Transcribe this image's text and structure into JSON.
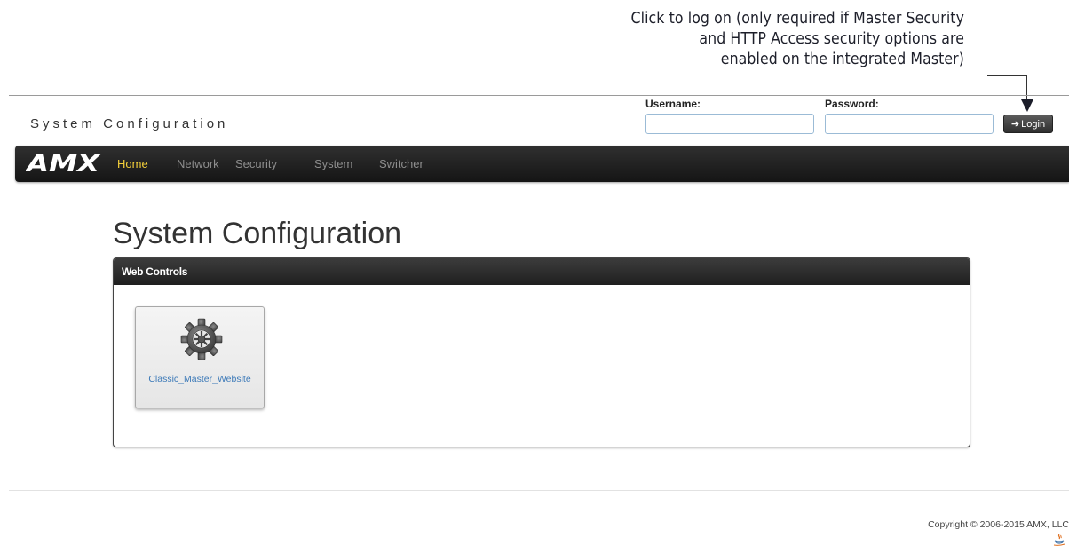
{
  "callout": {
    "lines": [
      "Click to log on (only required if Master Security",
      "and HTTP Access security options are",
      "enabled on the integrated Master)"
    ]
  },
  "header": {
    "app_title": "System Configuration",
    "username_label": "Username:",
    "password_label": "Password:",
    "username_value": "",
    "password_value": "",
    "login_icon": "login-icon",
    "login_label": "Login"
  },
  "nav": {
    "logo_text": "AMX",
    "items": [
      {
        "label": "Home",
        "active": true
      },
      {
        "label": "Network",
        "active": false
      },
      {
        "label": "Security",
        "active": false
      },
      {
        "label": "System",
        "active": false
      },
      {
        "label": "Switcher",
        "active": false
      }
    ],
    "active_color": "#f4d03a"
  },
  "main": {
    "heading": "System Configuration",
    "panel": {
      "title": "Web Controls",
      "tiles": [
        {
          "icon": "gear-icon",
          "label": "Classic_Master_Website"
        }
      ]
    }
  },
  "footer": {
    "copyright": "Copyright © 2006-2015 AMX, LLC",
    "java_icon": "java-icon"
  }
}
